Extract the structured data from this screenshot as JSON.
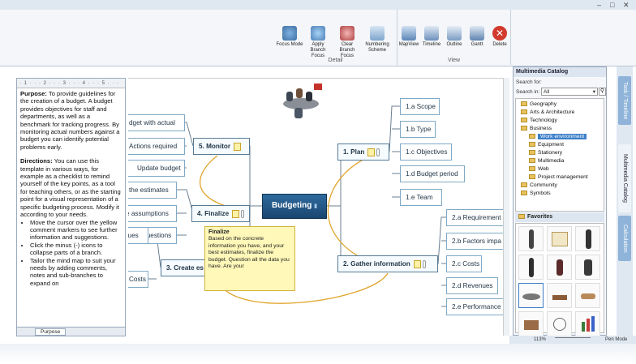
{
  "ribbon": {
    "groups": [
      {
        "label": "Detail",
        "buttons": [
          "Focus Mode",
          "Apply Branch Focus",
          "Clear Branch Focus",
          "Numbering Scheme"
        ]
      },
      {
        "label": "View",
        "buttons": [
          "MapView",
          "Timeline",
          "Outline",
          "Gantt",
          "Delete"
        ]
      }
    ]
  },
  "notes": {
    "ruler": "· 1 · · · 2 · · · 3 · · · 4 · · · 5 · · ·",
    "purpose_label": "Purpose:",
    "purpose_text": "To provide guidelines for the creation of a budget. A budget provides objectives for staff and departments, as well as a benchmark for tracking progress. By monitoring actual numbers against a budget you can identify potential problems early.",
    "directions_label": "Directions:",
    "directions_text": "You can use this template in various ways, for example as a checklist to remind yourself of the key points, as a tool for teaching others, or as the starting point for a visual representation of a specific budgeting process. Modify it according to your needs.",
    "bullets": [
      "Move the cursor over the yellow comment markers to see further information and suggestions.",
      "Click the minus (-) icons to collapse parts of a branch.",
      "Tailor the mind map to suit your needs by adding comments, notes and sub-branches to expand on"
    ],
    "tab": "Purpose"
  },
  "map": {
    "central": "Budgeting",
    "plan": {
      "label": "1.  Plan",
      "subs": [
        "1.a  Scope",
        "1.b  Type",
        "1.c  Objectives",
        "1.d  Budget period",
        "1.e  Team"
      ]
    },
    "gather": {
      "label": "2.  Gather information",
      "subs": [
        "2.a  Requirement",
        "2.b  Factors impa",
        "2.c  Costs",
        "2.d  Revenues",
        "2.e  Performance"
      ]
    },
    "create": {
      "label": "3.  Create es",
      "subs": [
        "nues",
        "Costs"
      ]
    },
    "finalize": {
      "label": "4.  Finalize",
      "subs": [
        "the estimates",
        "e assumptions",
        "\" questions"
      ]
    },
    "monitor": {
      "label": "5.  Monitor",
      "subs": [
        "dget with actual",
        "Actions required",
        "Update budget"
      ]
    }
  },
  "callout": {
    "title": "Finalize",
    "text": "Based on the concrete information you have, and your best estimates, finalize the budget. Question all the data you have. Are your"
  },
  "catalog": {
    "title": "Multimedia Catalog",
    "search_for_label": "Search for:",
    "search_in_label": "Search in:",
    "search_in_value": "All",
    "tree": [
      {
        "label": "Geography",
        "level": 1
      },
      {
        "label": "Arts & Architecture",
        "level": 1
      },
      {
        "label": "Technology",
        "level": 1
      },
      {
        "label": "Business",
        "level": 1
      },
      {
        "label": "Work environment",
        "level": 2,
        "selected": true
      },
      {
        "label": "Equipment",
        "level": 2
      },
      {
        "label": "Stationery",
        "level": 2
      },
      {
        "label": "Multimedia",
        "level": 2
      },
      {
        "label": "Web",
        "level": 2
      },
      {
        "label": "Project management",
        "level": 2
      },
      {
        "label": "Community",
        "level": 1
      },
      {
        "label": "Symbols",
        "level": 1
      }
    ],
    "favorites": "Favorites"
  },
  "side_tabs": [
    "Task / Timeline",
    "Multimedia Catalog",
    "Calculation"
  ],
  "status": {
    "zoom": "113%",
    "mode": "Pen Mode"
  },
  "colors": {
    "central_fill": "#1f4f7e",
    "callout_fill": "#fff8b8",
    "connector_curve": "#e0a52c",
    "ribbon_bg": "#f4f6f9"
  }
}
